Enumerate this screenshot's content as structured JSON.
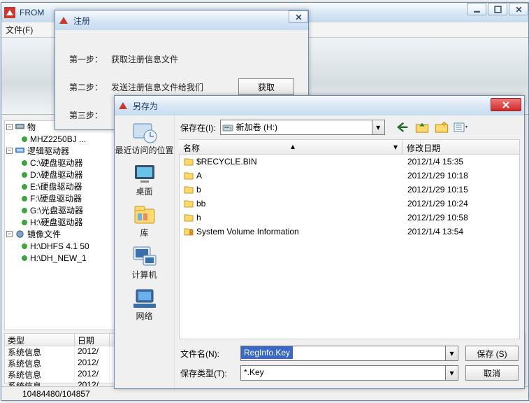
{
  "main_window": {
    "title": "FROM",
    "menu_file": "文件(F)",
    "tree": {
      "root1": "物",
      "line_mhz": "MHZ2250BJ ...",
      "logic": "逻辑驱动器",
      "c": "C:\\硬盘驱动器",
      "d": "D:\\硬盘驱动器",
      "e": "E:\\硬盘驱动器",
      "f": "F:\\硬盘驱动器",
      "g": "G:\\光盘驱动器",
      "h": "H:\\硬盘驱动器",
      "mirror": "镜像文件",
      "m1": "H:\\DHFS 4.1 50",
      "m2": "H:\\DH_NEW_1"
    },
    "grid": {
      "col1": "类型",
      "col2": "日期",
      "sysinfo": "系统信息",
      "d1": "2012/",
      "d2": "2012/",
      "d3": "2012/",
      "d4": "2012/"
    },
    "status": "10484480/104857"
  },
  "reg_dialog": {
    "title": "注册",
    "step1_lbl": "第一步：",
    "step1_txt": "获取注册信息文件",
    "step2_lbl": "第二步：",
    "step2_txt": "发送注册信息文件给我们",
    "step3_lbl": "第三步：",
    "get_btn": "获取"
  },
  "save_dialog": {
    "title": "另存为",
    "save_in_lbl": "保存在(I):",
    "drive": "新加卷 (H:)",
    "places": {
      "recent": "最近访问的位置",
      "desktop": "桌面",
      "libraries": "库",
      "computer": "计算机",
      "network": "网络"
    },
    "col_name": "名称",
    "col_date": "修改日期",
    "files": [
      {
        "name": "$RECYCLE.BIN",
        "date": "2012/1/4 15:35",
        "type": "folder"
      },
      {
        "name": "A",
        "date": "2012/1/29 10:18",
        "type": "folder"
      },
      {
        "name": "b",
        "date": "2012/1/29 10:15",
        "type": "folder"
      },
      {
        "name": "bb",
        "date": "2012/1/29 10:24",
        "type": "folder"
      },
      {
        "name": "h",
        "date": "2012/1/29 10:58",
        "type": "folder"
      },
      {
        "name": "System Volume Information",
        "date": "2012/1/4 13:54",
        "type": "lock"
      }
    ],
    "filename_lbl": "文件名(N):",
    "filename_val": "RegInfo.Key",
    "filetype_lbl": "保存类型(T):",
    "filetype_val": "*.Key",
    "save_btn": "保存 (S)",
    "cancel_btn": "取消"
  }
}
